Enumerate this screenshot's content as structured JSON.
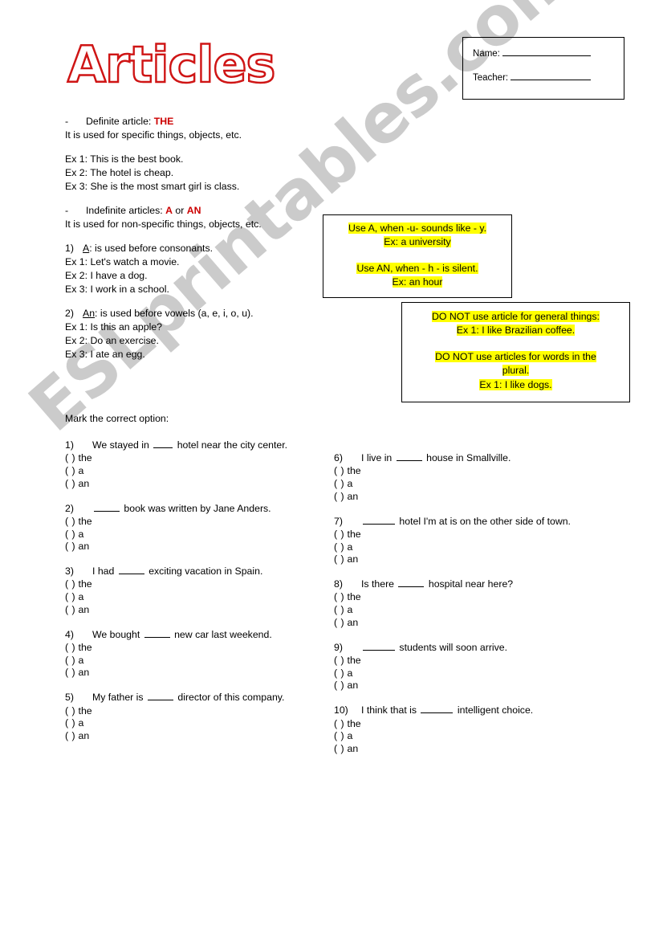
{
  "title": "Articles",
  "colors": {
    "title_outline": "#cf1515",
    "accent_red": "#cc0000",
    "highlight_yellow": "#ffff00",
    "watermark_gray": "#c9c9c9",
    "page_background": "#ffffff"
  },
  "watermark": {
    "text": "ESLprintables.com"
  },
  "name_box": {
    "name_label": "Name:",
    "teacher_label": "Teacher:"
  },
  "theory": {
    "definite": {
      "dash": "-",
      "heading_prefix": "Definite article: ",
      "heading_article": "THE",
      "usage": "It is used for specific things, objects, etc.",
      "examples": [
        "Ex 1: This is the best book.",
        "Ex 2: The hotel is cheap.",
        "Ex 3: She is the most smart girl is class."
      ]
    },
    "indefinite": {
      "dash": "-",
      "heading_prefix": "Indefinite articles: ",
      "heading_article_a": "A",
      "heading_or": " or ",
      "heading_article_an": "AN",
      "usage": "It is used for non-specific things, objects, etc.",
      "rule_1": {
        "number": "1)",
        "article": "A",
        "text": ": is used before consonants.",
        "examples": [
          "Ex 1: Let's watch a movie.",
          "Ex 2: I have a dog.",
          "Ex 3: I work in a school."
        ]
      },
      "rule_2": {
        "number": "2)",
        "article": "An",
        "text": ": is used before vowels (a, e, i, o, u).",
        "examples": [
          "Ex 1: Is this an apple?",
          "Ex 2: Do an exercise.",
          "Ex 3: I ate an egg."
        ]
      }
    }
  },
  "tip_box_1": {
    "line_1": "Use A, when -u- sounds like - y.",
    "line_2": "Ex: a university",
    "line_3": "Use AN, when - h - is silent.",
    "line_4": "Ex: an hour"
  },
  "tip_box_2": {
    "line_1": "DO NOT use article for general things:",
    "line_2": "Ex 1: I like Brazilian coffee.",
    "line_3": "DO NOT use articles for words in the",
    "line_4": "plural.",
    "line_5": "Ex 1: I like dogs."
  },
  "exercise": {
    "instruction": "Mark the correct option:",
    "options": [
      "the",
      "a",
      "an"
    ],
    "paren": "(  )",
    "questions_left": [
      {
        "number": "1)",
        "before": "We stayed in",
        "blank": "b3",
        "after": "hotel near the city center."
      },
      {
        "number": "2)",
        "before": "",
        "blank": "b4",
        "after": "book was written by Jane Anders."
      },
      {
        "number": "3)",
        "before": "I had",
        "blank": "b4",
        "after": "exciting vacation in Spain."
      },
      {
        "number": "4)",
        "before": "We bought",
        "blank": "b4",
        "after": "new car last weekend."
      },
      {
        "number": "5)",
        "before": "My father is",
        "blank": "b4",
        "after": "director of this company."
      }
    ],
    "questions_right": [
      {
        "number": "6)",
        "before": "I live in",
        "blank": "b4",
        "after": "house in Smallville."
      },
      {
        "number": "7)",
        "before": "",
        "blank": "b5",
        "after": "hotel I'm at is on the other side of town."
      },
      {
        "number": "8)",
        "before": "Is there",
        "blank": "b4",
        "after": "hospital near here?"
      },
      {
        "number": "9)",
        "before": "",
        "blank": "b5",
        "after": "students will soon arrive."
      },
      {
        "number": "10)",
        "before": "I think that is",
        "blank": "b5",
        "after": "intelligent choice."
      }
    ]
  }
}
